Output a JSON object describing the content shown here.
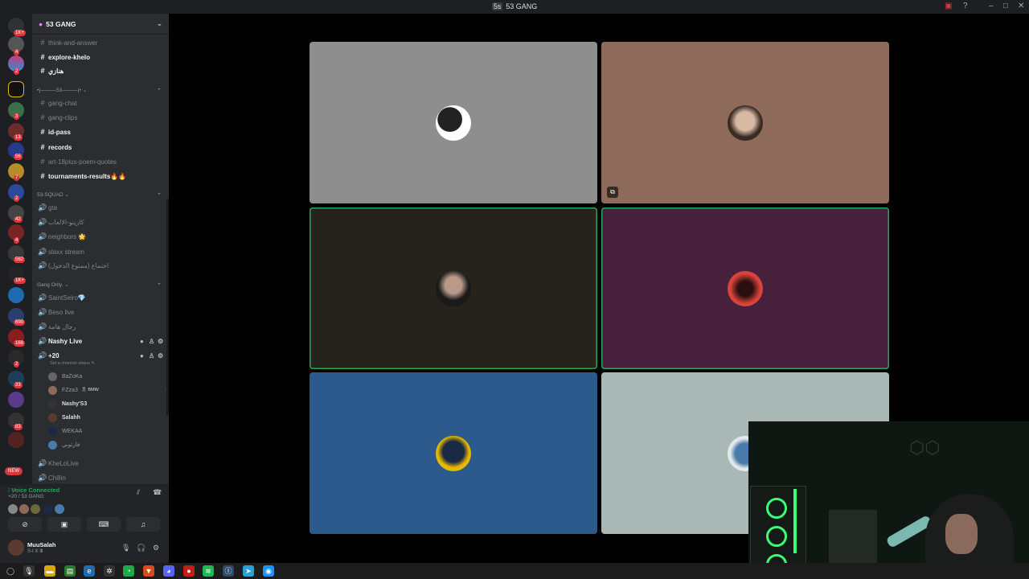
{
  "window": {
    "title": "53 GANG",
    "title_badge": "5s"
  },
  "server": {
    "name": "53 GANG"
  },
  "channels": [
    {
      "label": "think-and-answer",
      "icon": "hash-icon",
      "unread": false
    },
    {
      "label": "explore-khelo",
      "icon": "hash-icon",
      "unread": true
    },
    {
      "label": "هنازي",
      "icon": "hash-icon",
      "unread": true
    },
    {
      "label": "gang-chat",
      "icon": "hash-icon",
      "unread": false
    },
    {
      "label": "gang-clips",
      "icon": "hash-icon",
      "unread": false
    },
    {
      "label": "id-pass",
      "icon": "hash-icon",
      "unread": true
    },
    {
      "label": "records",
      "icon": "hash-icon",
      "unread": true
    },
    {
      "label": "art-18plus-poem-quotes",
      "icon": "hash-icon",
      "unread": false
    },
    {
      "label": "tournaments-results🔥🔥",
      "icon": "hash-icon",
      "unread": true
    }
  ],
  "categories": [
    {
      "label": "•)———53———(• ⌄"
    },
    {
      "label": "53-SQUAD ⌄"
    },
    {
      "label": "Gang Only. ⌄"
    }
  ],
  "voice_channels": [
    {
      "label": "gta"
    },
    {
      "label": "كازينو-الالعاب"
    },
    {
      "label": "neighbors 🌟"
    },
    {
      "label": "slaxx stream"
    },
    {
      "label": "اجتماع (ممنوع الدخول)"
    },
    {
      "label": "SaintSeiro💎"
    },
    {
      "label": "Beso live"
    },
    {
      "label": "رجال هامة"
    },
    {
      "label": "Nashy Live"
    },
    {
      "label": "+20"
    },
    {
      "label": "KheLoLive"
    },
    {
      "label": "Chillin"
    }
  ],
  "channel_status_hint": "Set a channel status",
  "voice_users": [
    {
      "name": "BaZoKa",
      "bold": false
    },
    {
      "name": "FZza3",
      "tag": "BMW",
      "bold": false
    },
    {
      "name": "Nashy'S3",
      "bold": true
    },
    {
      "name": "Salahh",
      "bold": true
    },
    {
      "name": "WEKAA",
      "bold": false
    },
    {
      "name": "فارتوني",
      "bold": false
    }
  ],
  "voice_connection": {
    "status": "Voice Connected",
    "location": "+20 / 53 GANG"
  },
  "user_panel": {
    "name": "MuuSalah",
    "status": "S-Ⅰ Ⅹ Ⅲ"
  },
  "rail_badges": [
    "1K+",
    "4",
    "2",
    "3",
    "13",
    "56",
    "7",
    "2",
    "42",
    "4",
    "562",
    "1K+",
    "690",
    "168",
    "2",
    "33",
    "83",
    "NEW"
  ],
  "colors": {
    "tile1": "#8e8e8e",
    "tile2": "#8e6a5a",
    "tile3": "#26221c",
    "tile4": "#47203b",
    "tile5": "#2c5a8c",
    "tile6": "#aab8b5",
    "voice_green": "#23a55a"
  }
}
